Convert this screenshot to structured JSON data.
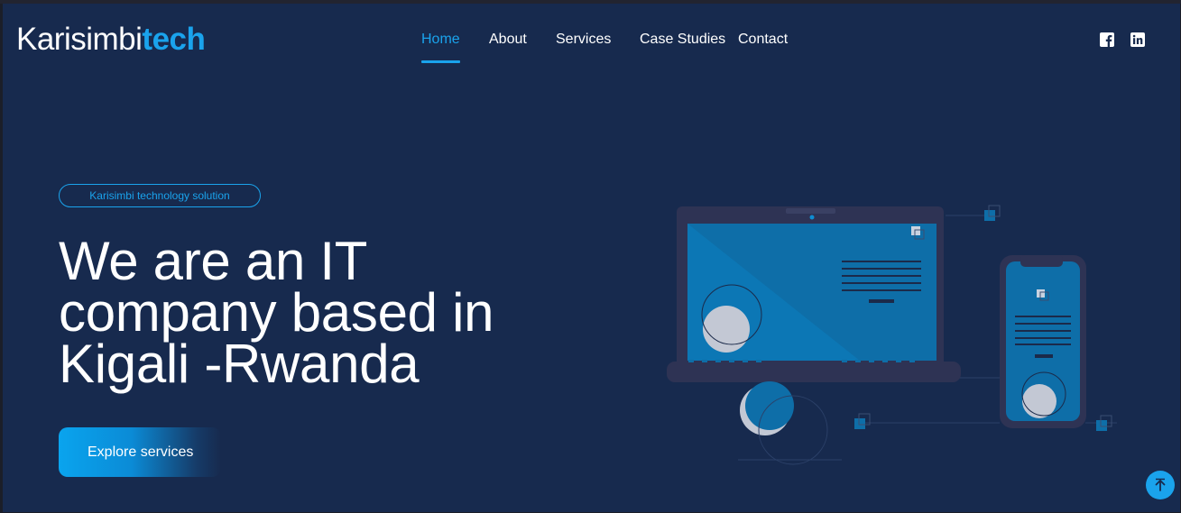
{
  "brand": {
    "name_part1": "Karisimbi",
    "name_part2": "tech"
  },
  "nav": {
    "items": [
      {
        "label": "Home",
        "active": true
      },
      {
        "label": "About",
        "active": false
      },
      {
        "label": "Services",
        "active": false
      },
      {
        "label": "Case Studies",
        "active": false
      },
      {
        "label": "Contact",
        "active": false
      }
    ]
  },
  "social": {
    "icons": [
      "facebook-icon",
      "linkedin-icon"
    ]
  },
  "hero": {
    "tagline": "Karisimbi technology solution",
    "headline": "We are an IT company based in Kigali -Rwanda",
    "cta_label": "Explore services"
  },
  "colors": {
    "background": "#172a4e",
    "accent": "#1aa3ec",
    "text": "#ffffff",
    "device_frame": "#2e3354",
    "screen": "#0e6ea8"
  },
  "scroll_top": {
    "icon": "arrow-up-icon"
  }
}
